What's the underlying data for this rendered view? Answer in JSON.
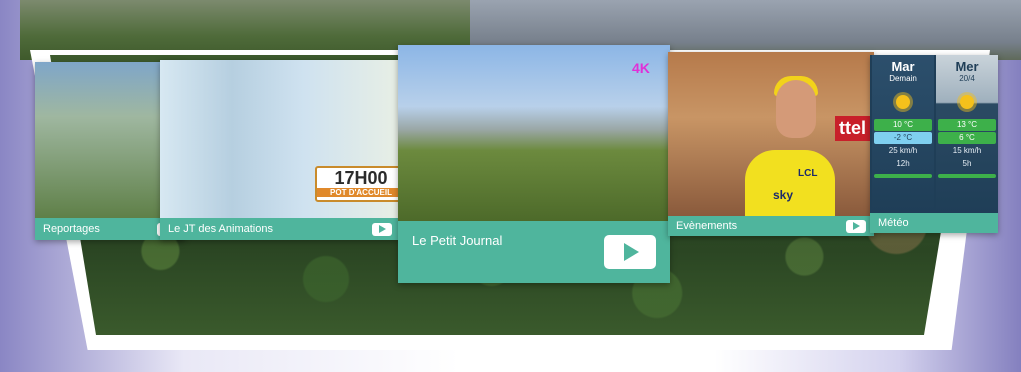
{
  "tiles": [
    {
      "label": "Reportages"
    },
    {
      "label": "Le JT des Animations",
      "sign_title": "17H00",
      "sign_sub": "POT D'ACCUEIL"
    },
    {
      "label": "Le Petit Journal",
      "logo": "4K"
    },
    {
      "label": "Evènements",
      "sponsor": "ttel",
      "jersey_text": "sky",
      "jersey_brand": "LCL"
    },
    {
      "label": "Météo"
    }
  ],
  "weather": {
    "left": {
      "day": "Mar",
      "sub": "Demain",
      "hi": "10 °C",
      "lo": "-2 °C",
      "wind": "25 km/h",
      "hours": "12h"
    },
    "right": {
      "day": "Mer",
      "sub": "20/4",
      "hi": "13 °C",
      "lo": "6 °C",
      "wind": "15 km/h",
      "hours": "5h"
    }
  },
  "colors": {
    "accent": "#4fb59d",
    "green": "#7cc14a",
    "weather_bg": "#1f3e57"
  }
}
